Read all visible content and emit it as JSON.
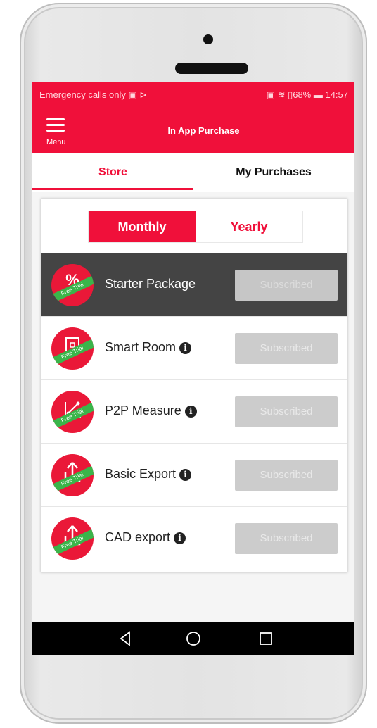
{
  "status_bar": {
    "left_text": "Emergency calls only ▣ ⊳",
    "right_text": "▣ ≋ ▯68% ▬ 14:57"
  },
  "app_bar": {
    "menu_label": "Menu",
    "title": "In App Purchase"
  },
  "tabs": [
    {
      "label": "Store",
      "active": true
    },
    {
      "label": "My Purchases",
      "active": false
    }
  ],
  "billing_toggle": {
    "options": [
      "Monthly",
      "Yearly"
    ],
    "selected": "Monthly"
  },
  "packages": [
    {
      "name": "Starter Package",
      "icon": "percent-icon",
      "ribbon": "Free Trial",
      "button": "Subscribed",
      "highlighted": true,
      "has_info": false
    },
    {
      "name": "Smart Room",
      "icon": "smart-room-icon",
      "ribbon": "Free Trial",
      "button": "Subscribed",
      "highlighted": false,
      "has_info": true
    },
    {
      "name": "P2P Measure",
      "icon": "p2p-measure-icon",
      "ribbon": "Free Trial",
      "button": "Subscribed",
      "highlighted": false,
      "has_info": true
    },
    {
      "name": "Basic Export",
      "icon": "export-icon",
      "ribbon": "Free Trial",
      "button": "Subscribed",
      "highlighted": false,
      "has_info": true
    },
    {
      "name": "CAD export",
      "icon": "export-icon",
      "ribbon": "Free Trial",
      "button": "Subscribed",
      "highlighted": false,
      "has_info": true
    }
  ],
  "colors": {
    "accent": "#f0103a",
    "ribbon": "#3ab54a",
    "highlight_row": "#444444"
  }
}
